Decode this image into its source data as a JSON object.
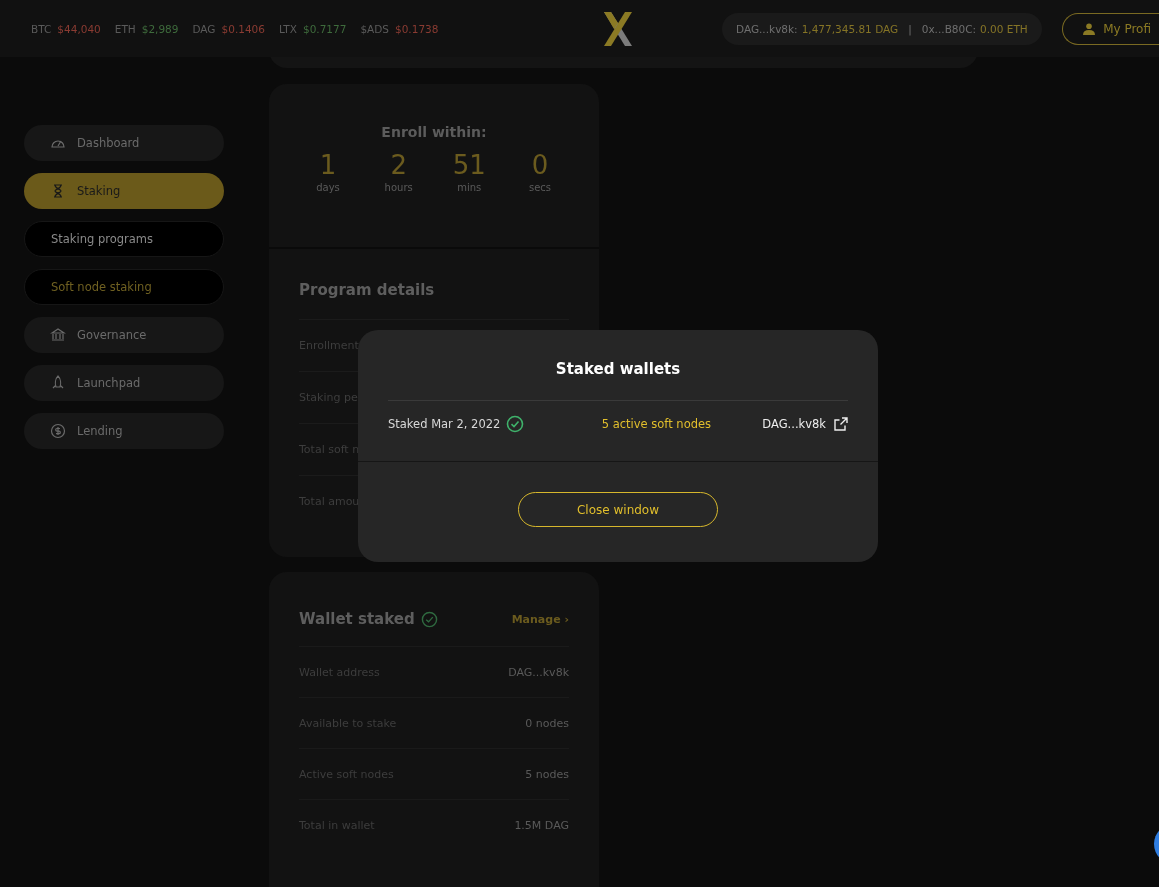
{
  "ticker": [
    {
      "symbol": "BTC",
      "price": "$44,040",
      "color": "#8a3b32"
    },
    {
      "symbol": "ETH",
      "price": "$2,989",
      "color": "#3e6b3c"
    },
    {
      "symbol": "DAG",
      "price": "$0.1406",
      "color": "#8a3b32"
    },
    {
      "symbol": "LTX",
      "price": "$0.7177",
      "color": "#3e6b3c"
    },
    {
      "symbol": "$ADS",
      "price": "$0.1738",
      "color": "#8a3b32"
    }
  ],
  "wallet_bar": {
    "dag_address": "DAG...kv8k:",
    "dag_balance": "1,477,345.81 DAG",
    "separator": "|",
    "eth_address": "0x...B80C:",
    "eth_balance": "0.00 ETH"
  },
  "profile_button": {
    "label": "My Profi"
  },
  "sidebar": {
    "items": [
      {
        "label": "Dashboard",
        "kind": "nav",
        "selected": false
      },
      {
        "label": "Staking",
        "kind": "nav",
        "selected": true
      },
      {
        "label": "Staking programs",
        "kind": "sub",
        "selected": false
      },
      {
        "label": "Soft node staking",
        "kind": "sub",
        "selected": true
      },
      {
        "label": "Governance",
        "kind": "nav",
        "selected": false
      },
      {
        "label": "Launchpad",
        "kind": "nav",
        "selected": false
      },
      {
        "label": "Lending",
        "kind": "nav",
        "selected": false
      }
    ]
  },
  "countdown": {
    "title": "Enroll within:",
    "units": [
      {
        "value": "1",
        "unit": "days"
      },
      {
        "value": "2",
        "unit": "hours"
      },
      {
        "value": "51",
        "unit": "mins"
      },
      {
        "value": "0",
        "unit": "secs"
      }
    ]
  },
  "program_details": {
    "title": "Program details",
    "rows": [
      "Enrollment",
      "Staking pe",
      "Total soft n",
      "Total amou"
    ]
  },
  "wallet_staked": {
    "title": "Wallet staked",
    "verified": true,
    "link": "Manage",
    "link_arrow": "›",
    "rows": [
      {
        "label": "Wallet address",
        "value": "DAG...kv8k"
      },
      {
        "label": "Available to stake",
        "value": "0 nodes"
      },
      {
        "label": "Active soft nodes",
        "value": "5 nodes"
      },
      {
        "label": "Total in wallet",
        "value": "1.5M DAG"
      }
    ]
  },
  "modal": {
    "title": "Staked wallets",
    "rows": [
      {
        "date": "Staked Mar 2, 2022",
        "verified": true,
        "nodes": "5 active soft nodes",
        "address": "DAG...kv8k"
      }
    ],
    "button": "Close window"
  }
}
